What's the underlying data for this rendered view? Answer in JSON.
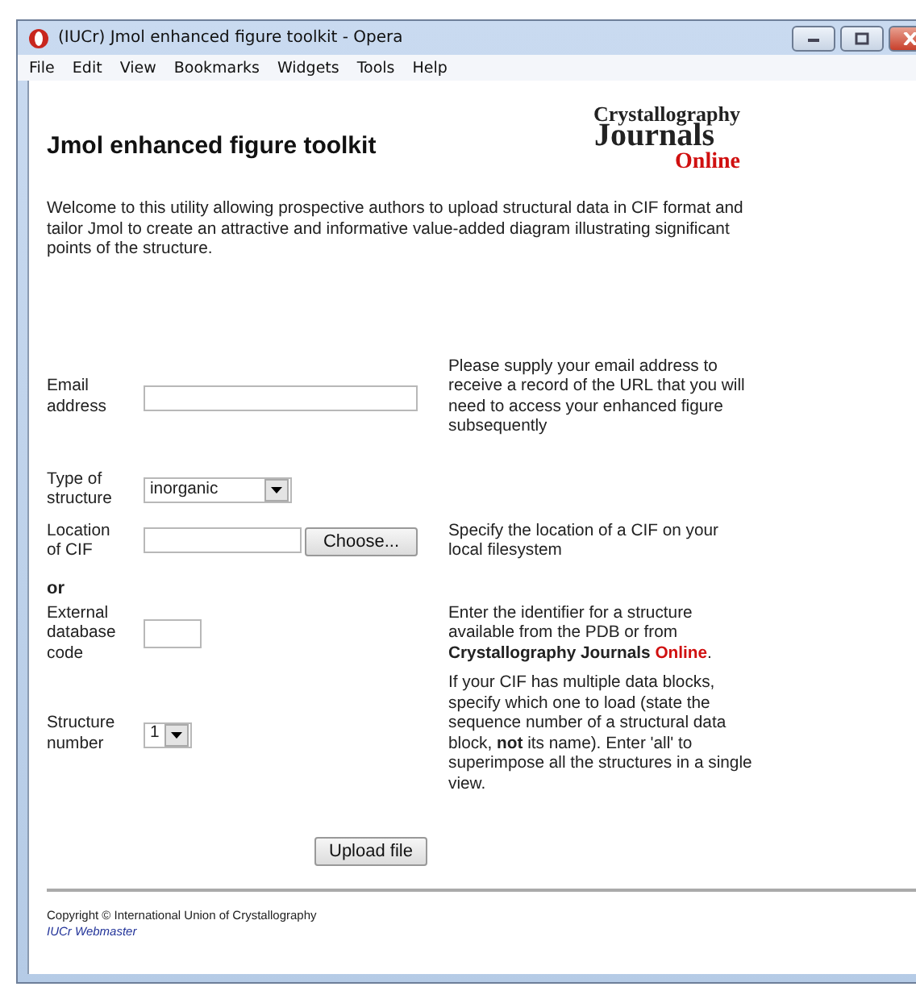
{
  "window": {
    "title": "(IUCr) Jmol enhanced figure toolkit - Opera"
  },
  "menu": [
    "File",
    "Edit",
    "View",
    "Bookmarks",
    "Widgets",
    "Tools",
    "Help"
  ],
  "page": {
    "heading": "Jmol enhanced figure toolkit",
    "logo": {
      "line_1": "Crystallography",
      "line_2": "Journals",
      "line_3": "Online"
    },
    "intro": "Welcome to this utility allowing prospective authors to upload structural data in CIF format and tailor Jmol to create an attractive and informative value-added diagram illustrating significant points of the structure."
  },
  "form": {
    "email": {
      "label": "Email address",
      "help": "Please supply your email address to receive a record of the URL that you will need to access your enhanced figure subsequently"
    },
    "type": {
      "label": "Type of structure",
      "value": "inorganic"
    },
    "location": {
      "label": "Location of CIF",
      "button": "Choose...",
      "help": "Specify the location of a CIF on your local filesystem"
    },
    "or": "or",
    "external": {
      "label": "External database code",
      "help_before": "Enter the identifier for a structure available from the PDB or from",
      "help_bold": "Crystallography Journals",
      "help_red": "Online",
      "help_after": "."
    },
    "structure": {
      "label": "Structure number",
      "value": "1",
      "help": "If your CIF has multiple data blocks, specify which one to load (state the sequence number of a structural data block, **not** its name). Enter 'all' to superimpose all the structures in a single view."
    },
    "submit": "Upload file"
  },
  "footer": {
    "copyright": "Copyright © International Union of Crystallography",
    "webmaster": "IUCr Webmaster"
  }
}
